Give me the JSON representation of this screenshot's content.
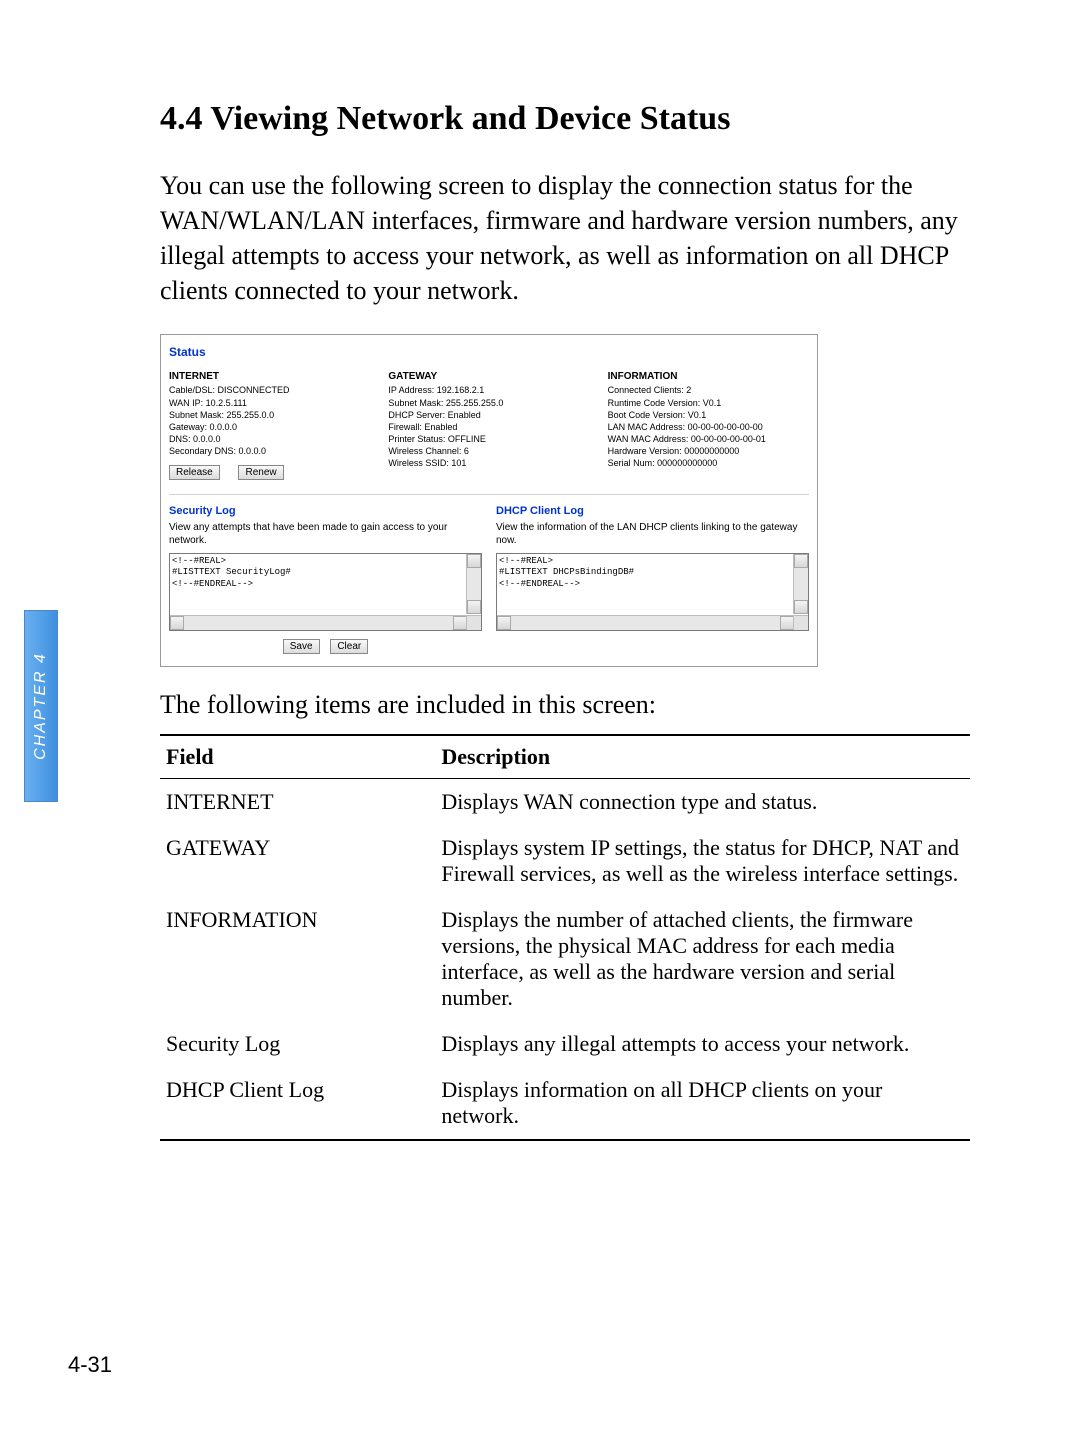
{
  "chapter_tab": "CHAPTER 4",
  "page_number": "4-31",
  "heading": "4.4 Viewing Network and Device Status",
  "intro": "You can use the following screen to display the connection status for the WAN/WLAN/LAN interfaces, firmware and hardware version numbers, any illegal attempts to access your network, as well as information on all DHCP clients connected to your network.",
  "after_fig": "The following items are included in this screen:",
  "status_panel": {
    "title": "Status",
    "internet": {
      "heading": "INTERNET",
      "lines": {
        "cable": "Cable/DSL: DISCONNECTED",
        "wanip": "WAN IP: 10.2.5.111",
        "mask": "Subnet Mask: 255.255.0.0",
        "gw": "Gateway: 0.0.0.0",
        "dns": "DNS: 0.0.0.0",
        "dns2": "Secondary DNS: 0.0.0.0"
      },
      "release_btn": "Release",
      "renew_btn": "Renew"
    },
    "gateway": {
      "heading": "GATEWAY",
      "lines": {
        "ip": "IP Address: 192.168.2.1",
        "mask": "Subnet Mask: 255.255.255.0",
        "dhcp": "DHCP Server: Enabled",
        "fw": "Firewall: Enabled",
        "ps": "Printer Status: OFFLINE",
        "ch": "Wireless Channel: 6",
        "ssid": "Wireless SSID: 101"
      }
    },
    "information": {
      "heading": "INFORMATION",
      "lines": {
        "cc": "Connected Clients: 2",
        "rt": "Runtime Code Version: V0.1",
        "boot": "Boot Code Version: V0.1",
        "lanmac": "LAN MAC Address: 00-00-00-00-00-00",
        "wanmac": "WAN MAC Address: 00-00-00-00-00-01",
        "hw": "Hardware Version: 00000000000",
        "sn": "Serial Num: 000000000000"
      }
    },
    "security_log": {
      "heading": "Security Log",
      "desc": "View any attempts that have been made to gain access to your network.",
      "content": "<!--#REAL>\n#LISTTEXT SecurityLog#\n<!--#ENDREAL-->",
      "save_btn": "Save",
      "clear_btn": "Clear"
    },
    "dhcp_log": {
      "heading": "DHCP Client Log",
      "desc": "View the information of the LAN DHCP clients linking to the gateway now.",
      "content": "<!--#REAL>\n#LISTTEXT DHCPsBindingDB#\n<!--#ENDREAL-->"
    }
  },
  "table": {
    "head": {
      "field": "Field",
      "desc": "Description"
    },
    "rows": [
      {
        "field": "INTERNET",
        "desc": "Displays WAN connection type and status."
      },
      {
        "field": "GATEWAY",
        "desc": "Displays system IP settings, the status for DHCP, NAT and Firewall services, as well as the wireless interface settings."
      },
      {
        "field": "INFORMATION",
        "desc": "Displays the number of attached clients, the firmware versions, the physical MAC address for each media interface, as well as the hardware version and serial number."
      },
      {
        "field": "Security Log",
        "desc": "Displays any illegal attempts to access your network."
      },
      {
        "field": "DHCP Client Log",
        "desc": "Displays information on all DHCP clients on your network."
      }
    ]
  }
}
